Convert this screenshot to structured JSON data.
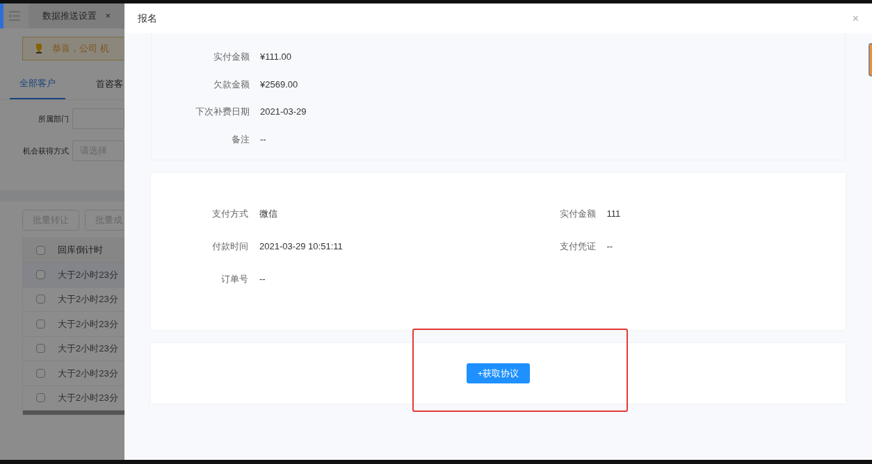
{
  "background": {
    "tab_title": "数据推送设置",
    "tab_close": "×",
    "banner_text": "恭喜，公司 机",
    "tabs": [
      {
        "label": "全部客户",
        "selected": true
      },
      {
        "label": "首咨客",
        "selected": false
      }
    ],
    "filters": [
      {
        "label": "所属部门"
      },
      {
        "label": "机会获得方式",
        "placeholder": "请选择"
      }
    ],
    "batch_buttons": [
      "批量转让",
      "批量成"
    ],
    "table": {
      "header": "回库倒计时",
      "header_checked": false,
      "rows": [
        {
          "text": "大于2小时23分",
          "checked": false
        },
        {
          "text": "大于2小时23分",
          "checked": false
        },
        {
          "text": "大于2小时23分",
          "checked": false
        },
        {
          "text": "大于2小时23分",
          "checked": false
        },
        {
          "text": "大于2小时23分",
          "checked": false
        },
        {
          "text": "大于2小时23分",
          "checked": false
        }
      ]
    }
  },
  "drawer": {
    "title": "报名",
    "close": "×",
    "summary_fields": [
      {
        "label": "实付金额",
        "value": "¥111.00"
      },
      {
        "label": "欠款金额",
        "value": "¥2569.00"
      },
      {
        "label": "下次补费日期",
        "value": "2021-03-29"
      },
      {
        "label": "备注",
        "value": "--"
      }
    ],
    "payment_fields": [
      {
        "label": "支付方式",
        "value": "微信"
      },
      {
        "label": "实付金额",
        "value": "111"
      },
      {
        "label": "付款时间",
        "value": "2021-03-29 10:51:11"
      },
      {
        "label": "支付凭证",
        "value": "--"
      },
      {
        "label": "订单号",
        "value": "--"
      }
    ],
    "agreement_button": "+获取协议"
  }
}
